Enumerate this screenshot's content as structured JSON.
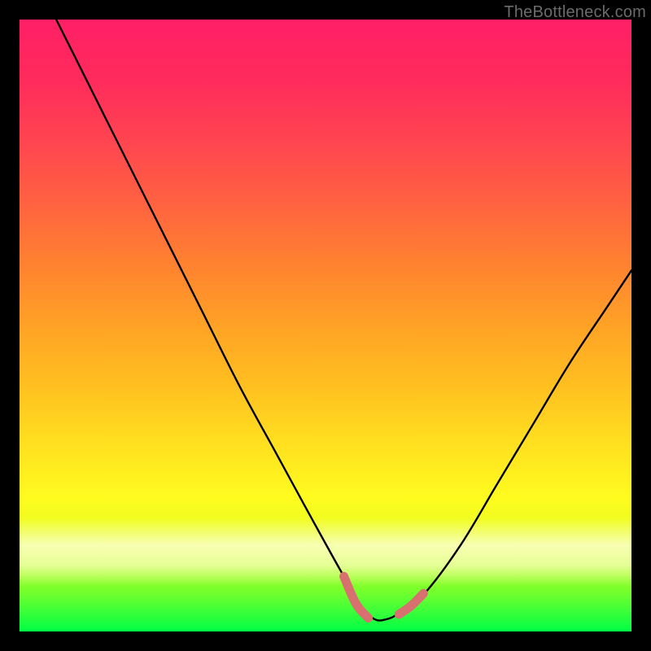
{
  "watermark": "TheBottleneck.com",
  "chart_data": {
    "type": "line",
    "title": "",
    "xlabel": "",
    "ylabel": "",
    "xlim": [
      0,
      100
    ],
    "ylim": [
      0,
      100
    ],
    "grid": false,
    "series": [
      {
        "name": "black-curve",
        "color": "#000000",
        "x": [
          6,
          12,
          18,
          24,
          30,
          36,
          42,
          48,
          53,
          56,
          58,
          60,
          62,
          66,
          72,
          78,
          84,
          90,
          96,
          100
        ],
        "y": [
          100,
          88,
          76,
          64,
          52,
          40,
          29,
          18,
          9,
          4,
          2,
          2,
          3,
          6,
          14,
          24,
          34,
          44,
          53,
          59
        ]
      },
      {
        "name": "pink-marker-left",
        "color": "#d97070",
        "x": [
          53,
          55,
          57
        ],
        "y": [
          9,
          4.5,
          2.2
        ]
      },
      {
        "name": "pink-marker-right",
        "color": "#d97070",
        "x": [
          62,
          64,
          66
        ],
        "y": [
          2.8,
          4.2,
          6.2
        ]
      }
    ],
    "note": "Axes have no tick labels in the source image; x and y are normalized 0–100. Curve is a bottleneck-style V with minimum near x≈60, right branch rises to about y≈59 at the right edge. Short coral/pink segments overlay the lower part of each branch near the minimum."
  }
}
